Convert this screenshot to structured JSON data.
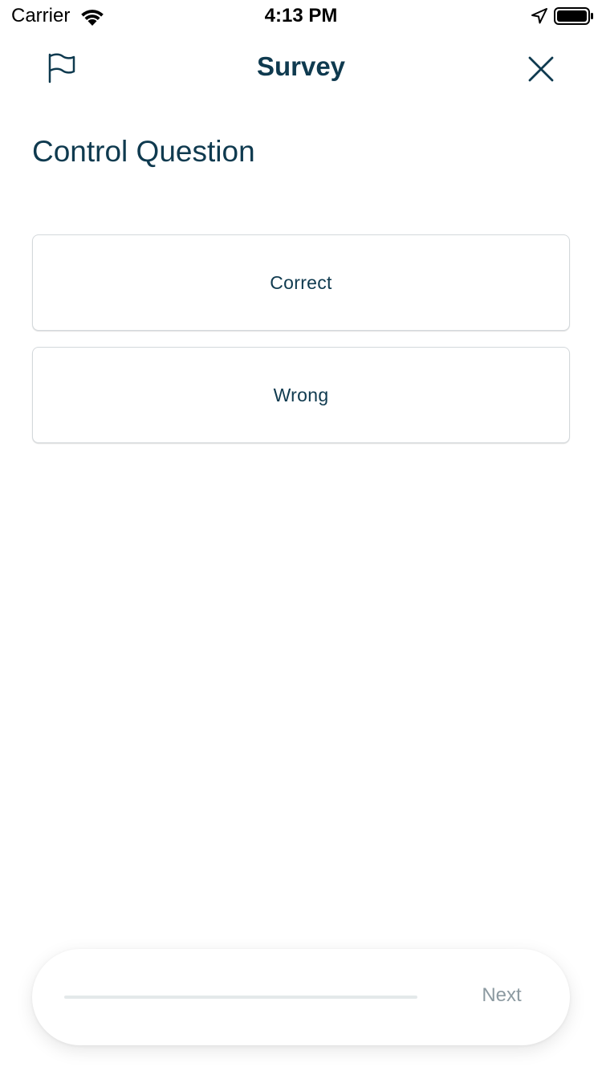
{
  "status_bar": {
    "carrier": "Carrier",
    "time": "4:13 PM"
  },
  "nav": {
    "title": "Survey",
    "flag_icon": "flag-icon",
    "close_icon": "close-icon"
  },
  "question": {
    "title": "Control Question",
    "options": [
      {
        "label": "Correct"
      },
      {
        "label": "Wrong"
      }
    ]
  },
  "footer": {
    "progress": 0,
    "next_label": "Next"
  },
  "colors": {
    "primary_text": "#0f3a4f",
    "muted_text": "#8c9aa1",
    "border": "#d3d8db",
    "progress_track": "#e4e9ea"
  }
}
